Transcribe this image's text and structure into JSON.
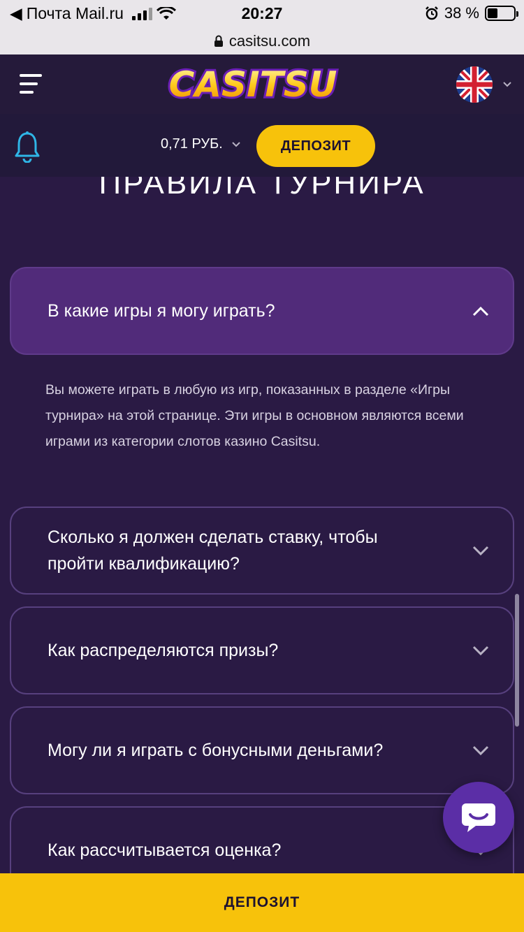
{
  "status_bar": {
    "back_app": "Почта Mail.ru",
    "time": "20:27",
    "battery": "38 %"
  },
  "url_bar": {
    "domain": "casitsu.com"
  },
  "header": {
    "logo_text": "CASITSU",
    "language_icon": "uk-flag-icon"
  },
  "balance_bar": {
    "balance": "0,71 РУБ.",
    "deposit_label": "ДЕПОЗИТ"
  },
  "main": {
    "section_title": "ПРАВИЛА ТУРНИРА",
    "faq": [
      {
        "question": "В какие игры я могу играть?",
        "open": true,
        "answer": "Вы можете играть в любую из игр, показанных в разделе «Игры турнира» на этой странице. Эти игры в основном являются всеми играми из категории слотов казино Casitsu."
      },
      {
        "question": "Сколько я должен сделать ставку, чтобы пройти квалификацию?",
        "open": false
      },
      {
        "question": "Как распределяются призы?",
        "open": false
      },
      {
        "question": "Могу ли я играть с бонусными деньгами?",
        "open": false
      },
      {
        "question": "Как рассчитывается оценка?",
        "open": false
      }
    ]
  },
  "footer": {
    "deposit_label": "ДЕПОЗИТ"
  },
  "colors": {
    "background": "#2a1a44",
    "accent_yellow": "#f7c20b",
    "faq_open": "#512b7a",
    "faq_border": "#57407e"
  }
}
